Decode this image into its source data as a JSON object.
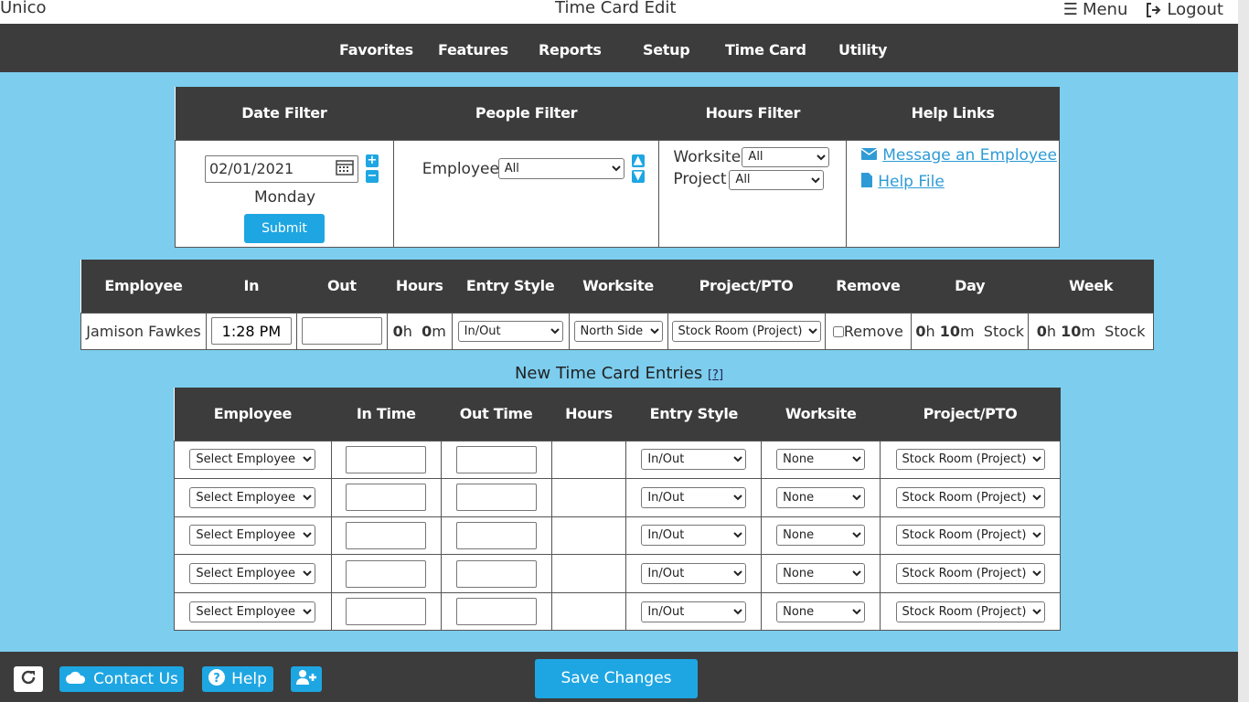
{
  "app": {
    "name": "Unico",
    "title": "Time Card Edit",
    "menu_label": "Menu",
    "logout_label": "Logout"
  },
  "nav": [
    "Favorites",
    "Features",
    "Reports",
    "Setup",
    "Time Card",
    "Utility"
  ],
  "filters": {
    "headers": [
      "Date Filter",
      "People Filter",
      "Hours Filter",
      "Help Links"
    ],
    "date_value": "02/01/2021",
    "day_name": "Monday",
    "submit_label": "Submit",
    "employee_label": "Employee",
    "employee_value": "All",
    "worksite_label": "Worksite",
    "worksite_value": "All",
    "project_label": "Project",
    "project_value": "All",
    "help_links": [
      "Message an Employee",
      "Help File"
    ]
  },
  "entries": {
    "headers": [
      "Employee",
      "In",
      "Out",
      "Hours",
      "Entry Style",
      "Worksite",
      "Project/PTO",
      "Remove",
      "Day",
      "Week"
    ],
    "rows": [
      {
        "employee": "Jamison Fawkes",
        "in": "1:28 PM",
        "out": "",
        "hours_h": "0",
        "hours_m": "0",
        "entry_style": "In/Out",
        "worksite": "North Side",
        "project": "Stock Room (Project)",
        "remove_label": "Remove",
        "day_h": "0",
        "day_m": "10",
        "day_label": "Stock",
        "week_h": "0",
        "week_m": "10",
        "week_label": "Stock"
      }
    ]
  },
  "new_entries": {
    "title": "New Time Card Entries",
    "help_marker": "[?]",
    "headers": [
      "Employee",
      "In Time",
      "Out Time",
      "Hours",
      "Entry Style",
      "Worksite",
      "Project/PTO"
    ],
    "defaults": {
      "employee": "Select Employee",
      "entry_style": "In/Out",
      "worksite": "None",
      "project": "Stock Room (Project)"
    },
    "row_count": 5
  },
  "footer": {
    "contact_label": "Contact Us",
    "help_label": "Help",
    "save_label": "Save Changes"
  }
}
